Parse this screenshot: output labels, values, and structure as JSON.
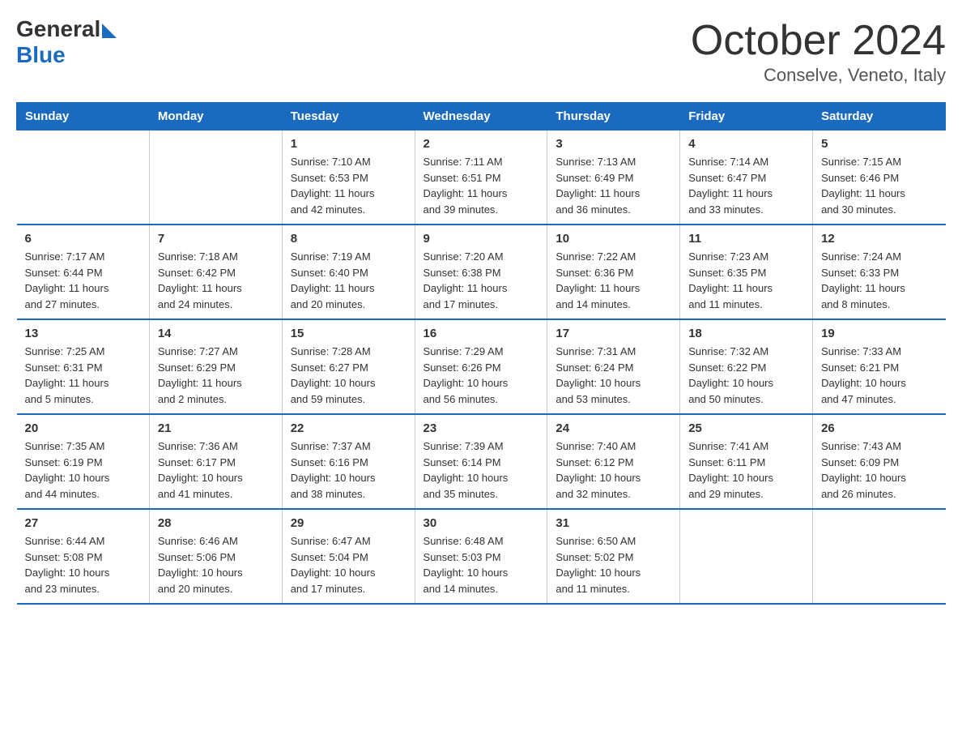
{
  "logo": {
    "general": "General",
    "blue": "Blue"
  },
  "title": "October 2024",
  "location": "Conselve, Veneto, Italy",
  "days_of_week": [
    "Sunday",
    "Monday",
    "Tuesday",
    "Wednesday",
    "Thursday",
    "Friday",
    "Saturday"
  ],
  "weeks": [
    [
      {
        "day": "",
        "info": ""
      },
      {
        "day": "",
        "info": ""
      },
      {
        "day": "1",
        "info": "Sunrise: 7:10 AM\nSunset: 6:53 PM\nDaylight: 11 hours\nand 42 minutes."
      },
      {
        "day": "2",
        "info": "Sunrise: 7:11 AM\nSunset: 6:51 PM\nDaylight: 11 hours\nand 39 minutes."
      },
      {
        "day": "3",
        "info": "Sunrise: 7:13 AM\nSunset: 6:49 PM\nDaylight: 11 hours\nand 36 minutes."
      },
      {
        "day": "4",
        "info": "Sunrise: 7:14 AM\nSunset: 6:47 PM\nDaylight: 11 hours\nand 33 minutes."
      },
      {
        "day": "5",
        "info": "Sunrise: 7:15 AM\nSunset: 6:46 PM\nDaylight: 11 hours\nand 30 minutes."
      }
    ],
    [
      {
        "day": "6",
        "info": "Sunrise: 7:17 AM\nSunset: 6:44 PM\nDaylight: 11 hours\nand 27 minutes."
      },
      {
        "day": "7",
        "info": "Sunrise: 7:18 AM\nSunset: 6:42 PM\nDaylight: 11 hours\nand 24 minutes."
      },
      {
        "day": "8",
        "info": "Sunrise: 7:19 AM\nSunset: 6:40 PM\nDaylight: 11 hours\nand 20 minutes."
      },
      {
        "day": "9",
        "info": "Sunrise: 7:20 AM\nSunset: 6:38 PM\nDaylight: 11 hours\nand 17 minutes."
      },
      {
        "day": "10",
        "info": "Sunrise: 7:22 AM\nSunset: 6:36 PM\nDaylight: 11 hours\nand 14 minutes."
      },
      {
        "day": "11",
        "info": "Sunrise: 7:23 AM\nSunset: 6:35 PM\nDaylight: 11 hours\nand 11 minutes."
      },
      {
        "day": "12",
        "info": "Sunrise: 7:24 AM\nSunset: 6:33 PM\nDaylight: 11 hours\nand 8 minutes."
      }
    ],
    [
      {
        "day": "13",
        "info": "Sunrise: 7:25 AM\nSunset: 6:31 PM\nDaylight: 11 hours\nand 5 minutes."
      },
      {
        "day": "14",
        "info": "Sunrise: 7:27 AM\nSunset: 6:29 PM\nDaylight: 11 hours\nand 2 minutes."
      },
      {
        "day": "15",
        "info": "Sunrise: 7:28 AM\nSunset: 6:27 PM\nDaylight: 10 hours\nand 59 minutes."
      },
      {
        "day": "16",
        "info": "Sunrise: 7:29 AM\nSunset: 6:26 PM\nDaylight: 10 hours\nand 56 minutes."
      },
      {
        "day": "17",
        "info": "Sunrise: 7:31 AM\nSunset: 6:24 PM\nDaylight: 10 hours\nand 53 minutes."
      },
      {
        "day": "18",
        "info": "Sunrise: 7:32 AM\nSunset: 6:22 PM\nDaylight: 10 hours\nand 50 minutes."
      },
      {
        "day": "19",
        "info": "Sunrise: 7:33 AM\nSunset: 6:21 PM\nDaylight: 10 hours\nand 47 minutes."
      }
    ],
    [
      {
        "day": "20",
        "info": "Sunrise: 7:35 AM\nSunset: 6:19 PM\nDaylight: 10 hours\nand 44 minutes."
      },
      {
        "day": "21",
        "info": "Sunrise: 7:36 AM\nSunset: 6:17 PM\nDaylight: 10 hours\nand 41 minutes."
      },
      {
        "day": "22",
        "info": "Sunrise: 7:37 AM\nSunset: 6:16 PM\nDaylight: 10 hours\nand 38 minutes."
      },
      {
        "day": "23",
        "info": "Sunrise: 7:39 AM\nSunset: 6:14 PM\nDaylight: 10 hours\nand 35 minutes."
      },
      {
        "day": "24",
        "info": "Sunrise: 7:40 AM\nSunset: 6:12 PM\nDaylight: 10 hours\nand 32 minutes."
      },
      {
        "day": "25",
        "info": "Sunrise: 7:41 AM\nSunset: 6:11 PM\nDaylight: 10 hours\nand 29 minutes."
      },
      {
        "day": "26",
        "info": "Sunrise: 7:43 AM\nSunset: 6:09 PM\nDaylight: 10 hours\nand 26 minutes."
      }
    ],
    [
      {
        "day": "27",
        "info": "Sunrise: 6:44 AM\nSunset: 5:08 PM\nDaylight: 10 hours\nand 23 minutes."
      },
      {
        "day": "28",
        "info": "Sunrise: 6:46 AM\nSunset: 5:06 PM\nDaylight: 10 hours\nand 20 minutes."
      },
      {
        "day": "29",
        "info": "Sunrise: 6:47 AM\nSunset: 5:04 PM\nDaylight: 10 hours\nand 17 minutes."
      },
      {
        "day": "30",
        "info": "Sunrise: 6:48 AM\nSunset: 5:03 PM\nDaylight: 10 hours\nand 14 minutes."
      },
      {
        "day": "31",
        "info": "Sunrise: 6:50 AM\nSunset: 5:02 PM\nDaylight: 10 hours\nand 11 minutes."
      },
      {
        "day": "",
        "info": ""
      },
      {
        "day": "",
        "info": ""
      }
    ]
  ]
}
